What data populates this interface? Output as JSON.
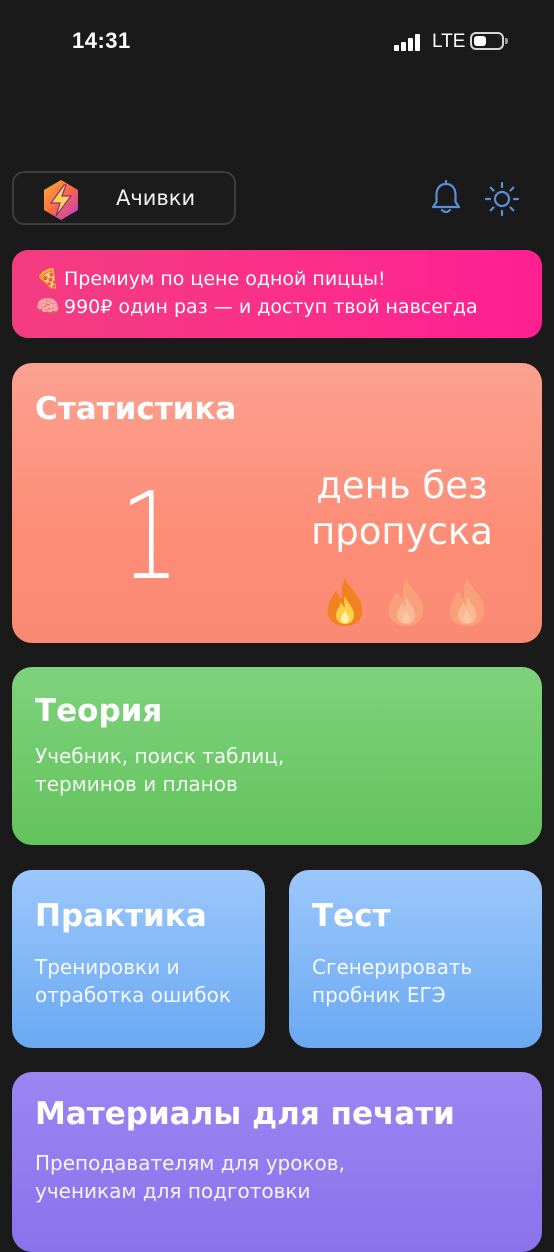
{
  "status_bar": {
    "time": "14:31",
    "network": "LTE"
  },
  "header": {
    "achievements_label": "Ачивки",
    "accent_color": "#5b8fd6"
  },
  "promo": {
    "line1_emoji": "🍕",
    "line1_text": "Премиум по цене одной пиццы!",
    "line2_emoji": "🧠",
    "line2_text": "990₽ один раз — и доступ твой навсегда",
    "color": "#fb2f8b"
  },
  "stats": {
    "title": "Статистика",
    "streak_days": "1",
    "streak_label_line1": "день без",
    "streak_label_line2": "пропуска",
    "flames_total": 3,
    "flames_active": 1
  },
  "theory": {
    "title": "Теория",
    "subtitle_line1": "Учебник, поиск таблиц,",
    "subtitle_line2": "терминов и планов"
  },
  "practice": {
    "title": "Практика",
    "subtitle_line1": "Тренировки и",
    "subtitle_line2": "отработка ошибок"
  },
  "test": {
    "title": "Тест",
    "subtitle_line1": "Сгенерировать",
    "subtitle_line2": "пробник ЕГЭ"
  },
  "print_materials": {
    "title": "Материалы для печати",
    "subtitle_line1": "Преподавателям для уроков,",
    "subtitle_line2": "ученикам для подготовки"
  }
}
